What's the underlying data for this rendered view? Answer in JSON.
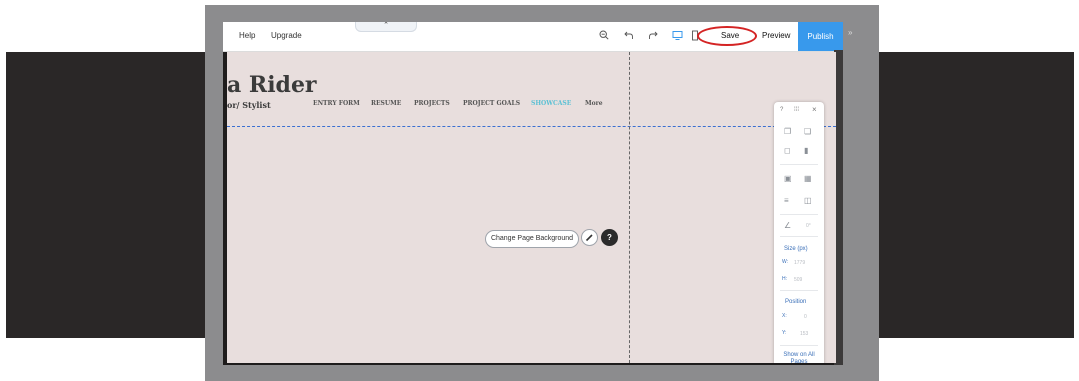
{
  "topbar": {
    "help": "Help",
    "upgrade": "Upgrade",
    "collapse_glyph": "⌃",
    "zoom_icon": "zoom-out-icon",
    "save": "Save",
    "preview": "Preview",
    "publish": "Publish",
    "collapse_panel": "»"
  },
  "site": {
    "name": "a Rider",
    "subtitle": "or/ Stylist",
    "nav": [
      "ENTRY FORM",
      "RESUME",
      "PROJECTS",
      "PROJECT GOALS",
      "SHOWCASE",
      "More"
    ],
    "active_nav": "SHOWCASE"
  },
  "canvas": {
    "change_bg": "Change Page Background",
    "background_color": "#e8dedd"
  },
  "panel": {
    "help": "?",
    "drag": "⁞⁞⁞",
    "close": "×",
    "rotation": "0°",
    "size_label": "Size (px)",
    "w_label": "W:",
    "w_value": "1779",
    "h_label": "H:",
    "h_value": "509",
    "position_label": "Position",
    "x_label": "X:",
    "x_value": "0",
    "y_label": "Y:",
    "y_value": "153",
    "show_all": "Show on All Pages",
    "show_all_on": false
  },
  "colors": {
    "publish_bg": "#3899ec",
    "highlight_circle": "#d42424",
    "guide_line": "#3b6fd1",
    "active_nav": "#5bc0d4"
  }
}
